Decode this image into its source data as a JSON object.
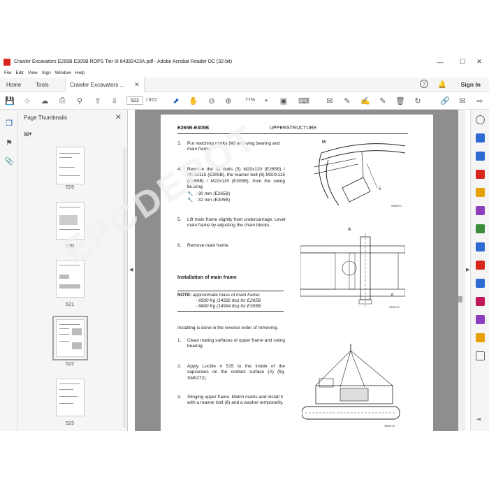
{
  "window": {
    "title": "Crawler Excavators E265B E305B ROPS Tier III 84392423A.pdf - Adobe Acrobat Reader DC (32-bit)"
  },
  "menu": [
    "File",
    "Edit",
    "View",
    "Sign",
    "Window",
    "Help"
  ],
  "tabs": {
    "home": "Home",
    "tools": "Tools",
    "doc": "Crawler Excavators ..."
  },
  "signin": "Sign In",
  "toolbar": {
    "page_value": "522",
    "page_total": "/ 872",
    "zoom": "77%"
  },
  "thumbnails": {
    "title": "Page Thumbnails",
    "pages": [
      "519",
      "520",
      "521",
      "522",
      "523"
    ],
    "selected": "522"
  },
  "document": {
    "header_left": "E265B-E305B",
    "header_right": "UPPERSTRUCTURE",
    "steps_top": [
      {
        "n": "3.",
        "text": "Put matching marks (M) on swing bearing and main frame."
      },
      {
        "n": "4.",
        "text": "Remove the 32 bolts (5) M20x120 (E265B) / M22X115 (E305B), the reamer bolt (6) M20X115 (E265B) / M22x115 (E305B), from the swing bearing."
      },
      {
        "n": "5.",
        "text": "Lift main frame slightly from undercarriage. Level main frame by adjusting the chain blocks."
      },
      {
        "n": "6.",
        "text": "Remove main frame."
      }
    ],
    "wrench1": ": 30 mm (E265B)",
    "wrench2": ": 32 mm (E305B)",
    "section_title": "Installation of main frame",
    "note_label": "NOTE:",
    "note_text": "approximate mass of main frame:",
    "note_line1": "- 6500 Kg (14332 lbs) for E265B",
    "note_line2": "- 6800 Kg (14994 lbs) for E305B",
    "reverse": "Installing is done in the reverse order of removing.",
    "steps_bottom": [
      {
        "n": "1.",
        "text": "Clean mating surfaces of upper frame and swing bearing."
      },
      {
        "n": "2.",
        "text": "Apply Loctite # 515 to the inside of the capscrews on the contact surface (A) (fig. SM0272)."
      },
      {
        "n": "3.",
        "text": "Slinging upper frame. Match marks and install it with a reamer bolt (6) and a washer temporarily."
      }
    ],
    "fig1": {
      "label_m": "M",
      "label_5": "5",
      "code": "SM02F1"
    },
    "fig2": {
      "label_a": "A",
      "label_6": "6",
      "code": "SM0272"
    },
    "fig3": {
      "code": "SM0273"
    }
  },
  "watermark": "EPCDEPOT",
  "colors": {
    "acrobat_red": "#d9261c",
    "doc_bg": "#8e8e8e",
    "panel_bg": "#f5f5f5"
  }
}
